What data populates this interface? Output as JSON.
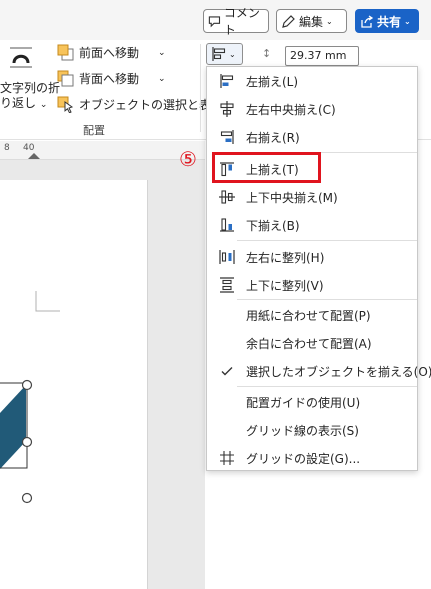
{
  "toolbar": {
    "comment_label": "コメント",
    "edit_label": "編集",
    "share_label": "共有"
  },
  "ribbon": {
    "wrap_text_label_line1": "文字列の折",
    "wrap_text_label_line2": "り返し",
    "bring_forward_label": "前面へ移動",
    "send_backward_label": "背面へ移動",
    "selection_pane_label": "オブジェクトの選択と表示",
    "group_label": "配置",
    "size_value": "29.37 mm"
  },
  "ruler": {
    "tick_8": "8",
    "tick_40": "40"
  },
  "step_marker": "⑤",
  "align_menu": {
    "items": [
      {
        "label": "左揃え(L)",
        "icon": "align-left-icon"
      },
      {
        "label": "左右中央揃え(C)",
        "icon": "align-center-icon"
      },
      {
        "label": "右揃え(R)",
        "icon": "align-right-icon"
      },
      {
        "label": "上揃え(T)",
        "icon": "align-top-icon"
      },
      {
        "label": "上下中央揃え(M)",
        "icon": "align-middle-icon"
      },
      {
        "label": "下揃え(B)",
        "icon": "align-bottom-icon"
      },
      {
        "label": "左右に整列(H)",
        "icon": "distribute-horizontal-icon"
      },
      {
        "label": "上下に整列(V)",
        "icon": "distribute-vertical-icon"
      },
      {
        "label": "用紙に合わせて配置(P)",
        "icon": ""
      },
      {
        "label": "余白に合わせて配置(A)",
        "icon": ""
      },
      {
        "label": "選択したオブジェクトを揃える(O)",
        "icon": "check-icon"
      },
      {
        "label": "配置ガイドの使用(U)",
        "icon": ""
      },
      {
        "label": "グリッド線の表示(S)",
        "icon": ""
      },
      {
        "label": "グリッドの設定(G)...",
        "icon": "grid-icon"
      }
    ]
  },
  "colors": {
    "accent_blue": "#1a63c7",
    "highlight_red": "#e0141e",
    "shape_fill": "#215a78",
    "icon_blue": "#2b6fc4"
  }
}
